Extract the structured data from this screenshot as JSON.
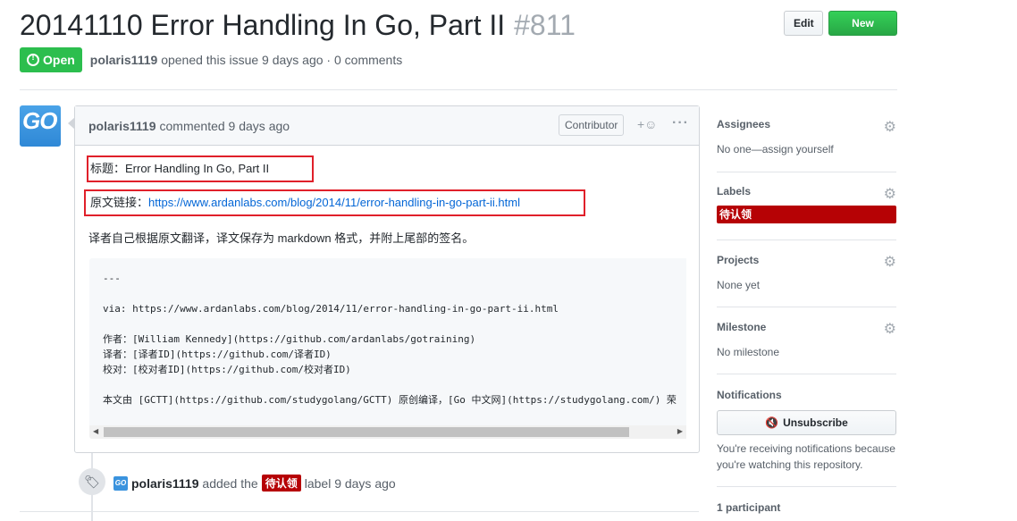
{
  "issue": {
    "title": "20141110 Error Handling In Go, Part II",
    "number": "#811",
    "state": "Open",
    "author": "polaris1119",
    "meta_suffix": "opened this issue 9 days ago · 0 comments"
  },
  "header_actions": {
    "edit_label": "Edit",
    "new_issue_label": "New issue"
  },
  "comment": {
    "author": "polaris1119",
    "when": "commented 9 days ago",
    "role_badge": "Contributor",
    "reaction_icon": "smiley-icon",
    "more_icon": "kebab-icon",
    "line1": "标题：Error Handling In Go, Part II",
    "line2_prefix": "原文链接：",
    "line2_link": "https://www.ardanlabs.com/blog/2014/11/error-handling-in-go-part-ii.html",
    "line3": "译者自己根据原文翻译，译文保存为 markdown 格式，并附上尾部的签名。",
    "code": "---\n\nvia: https://www.ardanlabs.com/blog/2014/11/error-handling-in-go-part-ii.html\n\n作者：[William Kennedy](https://github.com/ardanlabs/gotraining)\n译者：[译者ID](https://github.com/译者ID)\n校对：[校对者ID](https://github.com/校对者ID)\n\n本文由 [GCTT](https://github.com/studygolang/GCTT) 原创编译，[Go 中文网](https://studygolang.com/) 荣"
  },
  "timeline_event": {
    "actor": "polaris1119",
    "action": "added the",
    "label": "待认领",
    "suffix": "label 9 days ago"
  },
  "sidebar": {
    "assignees_title": "Assignees",
    "assignees_value": "No one—assign yourself",
    "labels_title": "Labels",
    "label_value": "待认领",
    "projects_title": "Projects",
    "projects_value": "None yet",
    "milestone_title": "Milestone",
    "milestone_value": "No milestone",
    "notifications_title": "Notifications",
    "unsubscribe_label": "Unsubscribe",
    "notifications_text": "You're receiving notifications because you're watching this repository.",
    "participants": "1 participant"
  },
  "colors": {
    "open_green": "#2cbe4e",
    "label_red": "#b60205",
    "highlight_red": "#e0202a",
    "link_blue": "#0366d6"
  }
}
